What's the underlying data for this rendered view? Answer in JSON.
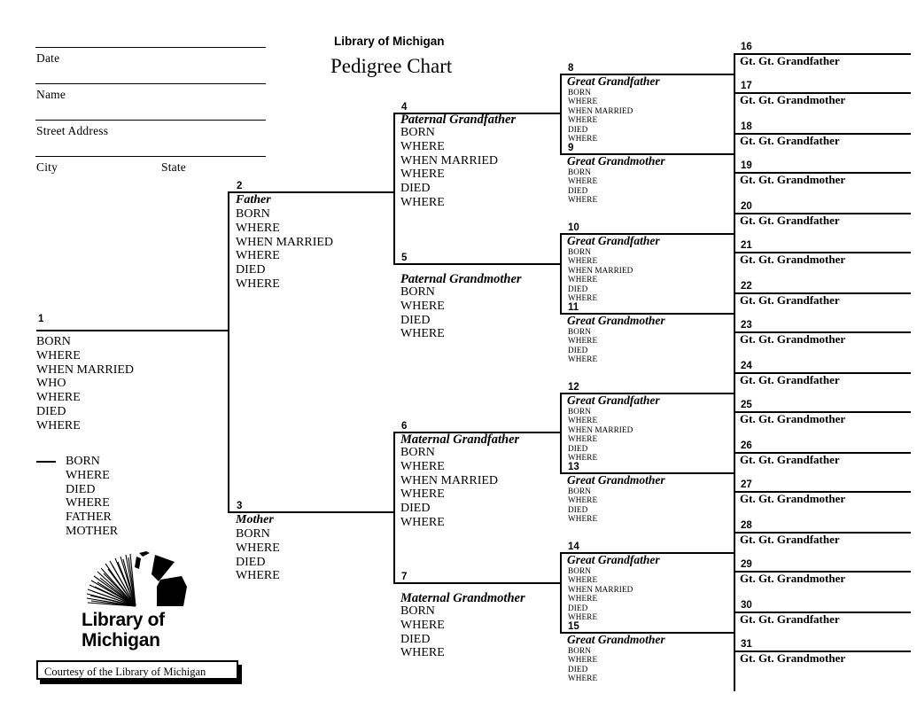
{
  "header": {
    "title_org": "Library of Michigan",
    "title_main": "Pedigree Chart",
    "form_fields": [
      {
        "label": "Date"
      },
      {
        "label": "Name"
      },
      {
        "label": "Street Address"
      },
      {
        "label": "City"
      },
      {
        "label": "State"
      }
    ]
  },
  "logo": {
    "name": "Library of\nMichigan",
    "mark": "library-of-michigan-fan-logo"
  },
  "footer": {
    "text": "Courtesy of the Library of Michigan"
  },
  "chart": {
    "person1": {
      "number": "1",
      "fields": "BORN\nWHERE\nWHEN MARRIED\nWHO\nWHERE\nDIED\nWHERE",
      "spouse_fields": "BORN\nWHERE\nDIED\nWHERE\nFATHER\nMOTHER"
    },
    "generation2": [
      {
        "number": "2",
        "name": "Father",
        "fields": "BORN\nWHERE\nWHEN MARRIED\nWHERE\nDIED\nWHERE"
      },
      {
        "number": "3",
        "name": "Mother",
        "fields": "BORN\nWHERE\nDIED\nWHERE"
      }
    ],
    "generation3": [
      {
        "number": "4",
        "name": "Paternal Grandfather",
        "fields": "BORN\nWHERE\nWHEN MARRIED\nWHERE\nDIED\nWHERE"
      },
      {
        "number": "5",
        "name": "Paternal Grandmother",
        "fields": "BORN\nWHERE\nDIED\nWHERE"
      },
      {
        "number": "6",
        "name": "Maternal Grandfather",
        "fields": "BORN\nWHERE\nWHEN MARRIED\nWHERE\nDIED\nWHERE"
      },
      {
        "number": "7",
        "name": "Maternal Grandmother",
        "fields": "BORN\nWHERE\nDIED\nWHERE"
      }
    ],
    "generation4": [
      {
        "number": "8",
        "name": "Great Grandfather",
        "fields": "BORN\nWHERE\nWHEN MARRIED\nWHERE\nDIED\nWHERE"
      },
      {
        "number": "9",
        "name": "Great Grandmother",
        "fields": "BORN\nWHERE\nDIED\nWHERE"
      },
      {
        "number": "10",
        "name": "Great Grandfather",
        "fields": "BORN\nWHERE\nWHEN MARRIED\nWHERE\nDIED\nWHERE"
      },
      {
        "number": "11",
        "name": "Great Grandmother",
        "fields": "BORN\nWHERE\nDIED\nWHERE"
      },
      {
        "number": "12",
        "name": "Great Grandfather",
        "fields": "BORN\nWHERE\nWHEN MARRIED\nWHERE\nDIED\nWHERE"
      },
      {
        "number": "13",
        "name": "Great Grandmother",
        "fields": "BORN\nWHERE\nDIED\nWHERE"
      },
      {
        "number": "14",
        "name": "Great Grandfather",
        "fields": "BORN\nWHERE\nWHEN MARRIED\nWHERE\nDIED\nWHERE"
      },
      {
        "number": "15",
        "name": "Great Grandmother",
        "fields": "BORN\nWHERE\nDIED\nWHERE"
      }
    ],
    "generation5": [
      {
        "number": "16",
        "name": "Gt. Gt. Grandfather"
      },
      {
        "number": "17",
        "name": "Gt. Gt. Grandmother"
      },
      {
        "number": "18",
        "name": "Gt. Gt. Grandfather"
      },
      {
        "number": "19",
        "name": "Gt. Gt. Grandmother"
      },
      {
        "number": "20",
        "name": "Gt. Gt. Grandfather"
      },
      {
        "number": "21",
        "name": "Gt. Gt. Grandmother"
      },
      {
        "number": "22",
        "name": "Gt. Gt. Grandfather"
      },
      {
        "number": "23",
        "name": "Gt. Gt. Grandmother"
      },
      {
        "number": "24",
        "name": "Gt. Gt. Grandfather"
      },
      {
        "number": "25",
        "name": "Gt. Gt. Grandmother"
      },
      {
        "number": "26",
        "name": "Gt. Gt. Grandfather"
      },
      {
        "number": "27",
        "name": "Gt. Gt. Grandmother"
      },
      {
        "number": "28",
        "name": "Gt. Gt. Grandfather"
      },
      {
        "number": "29",
        "name": "Gt. Gt. Grandmother"
      },
      {
        "number": "30",
        "name": "Gt. Gt. Grandfather"
      },
      {
        "number": "31",
        "name": "Gt. Gt. Grandmother"
      }
    ]
  }
}
